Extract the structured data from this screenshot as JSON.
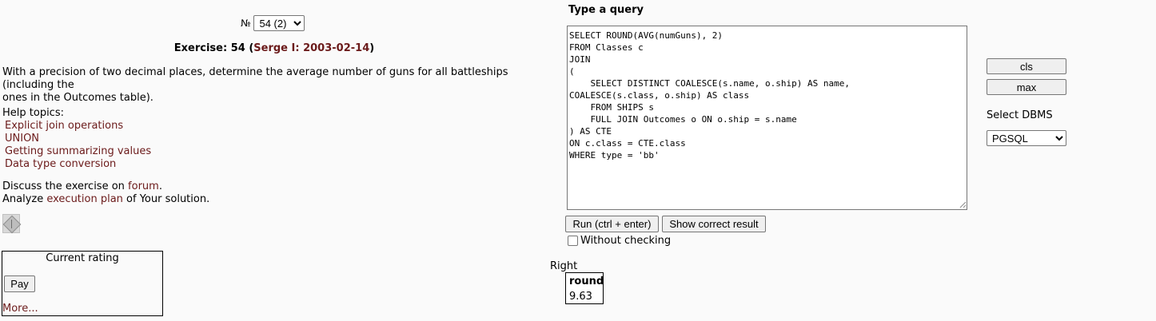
{
  "exercise_selector": {
    "number_sign": "№",
    "selected": "54 (2)"
  },
  "exercise": {
    "title_prefix": "Exercise: 54 (",
    "author_date": "Serge I: 2003-02-14",
    "title_suffix": ")",
    "text_line1": "With a precision of two decimal places, determine the average number of guns for all battleships (including the",
    "text_line2": "ones in the Outcomes table)."
  },
  "help": {
    "label": "Help topics:",
    "topics": [
      "Explicit join operations",
      "UNION",
      "Getting summarizing values",
      "Data type conversion"
    ]
  },
  "discuss": {
    "prefix": "Discuss the exercise on ",
    "forum_link": "forum",
    "suffix": ".",
    "analyze_prefix": "Analyze ",
    "plan_link": "execution plan",
    "analyze_suffix": " of Your solution."
  },
  "rating": {
    "title": "Current rating",
    "pay_label": "Pay",
    "more_link": "More..."
  },
  "query": {
    "label": "Type a query",
    "text": "SELECT ROUND(AVG(numGuns), 2)\nFROM Classes c\nJOIN\n(\n    SELECT DISTINCT COALESCE(s.name, o.ship) AS name,\nCOALESCE(s.class, o.ship) AS class\n    FROM SHIPS s\n    FULL JOIN Outcomes o ON o.ship = s.name\n) AS CTE\nON c.class = CTE.class\nWHERE type = 'bb'"
  },
  "actions": {
    "run_label": "Run (ctrl + enter)",
    "correct_label": "Show correct result",
    "without_checking": "Without checking"
  },
  "result": {
    "status": "Right",
    "column": "round",
    "value": "9.63"
  },
  "side": {
    "cls_label": "cls",
    "max_label": "max",
    "dbms_label": "Select DBMS",
    "dbms_selected": "PGSQL"
  }
}
